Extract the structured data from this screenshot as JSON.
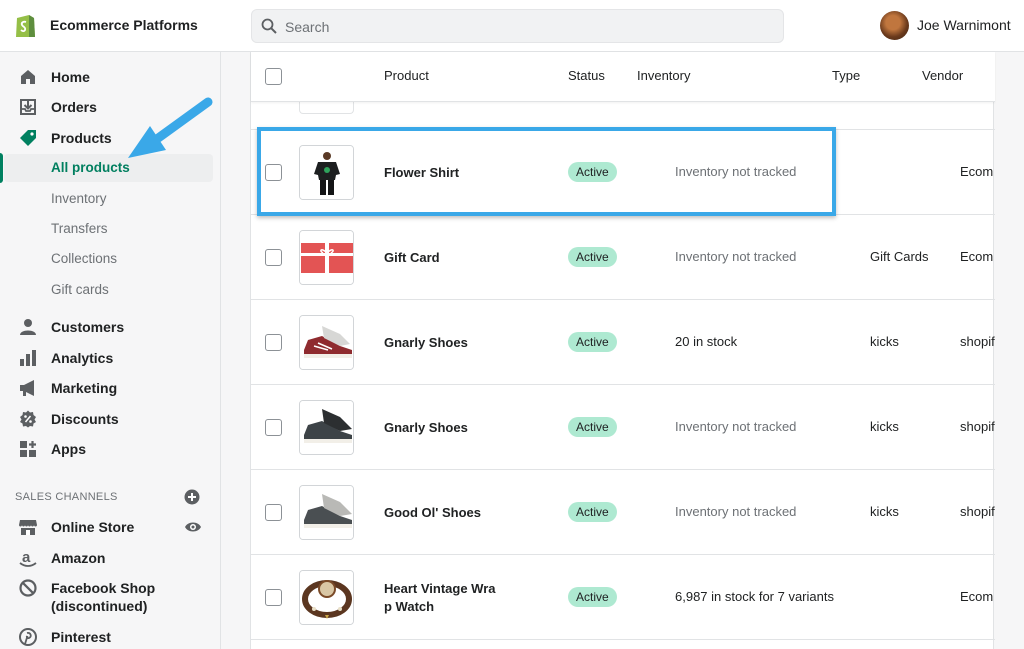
{
  "topbar": {
    "store_name": "Ecommerce Platforms",
    "search_placeholder": "Search",
    "user_name": "Joe Warnimont"
  },
  "sidebar": {
    "items": [
      {
        "label": "Home",
        "icon": "home-icon"
      },
      {
        "label": "Orders",
        "icon": "orders-icon"
      },
      {
        "label": "Products",
        "icon": "tag-icon"
      }
    ],
    "product_sub_items": [
      {
        "label": "All products",
        "active": true
      },
      {
        "label": "Inventory"
      },
      {
        "label": "Transfers"
      },
      {
        "label": "Collections"
      },
      {
        "label": "Gift cards"
      }
    ],
    "more_items": [
      {
        "label": "Customers",
        "icon": "customers-icon"
      },
      {
        "label": "Analytics",
        "icon": "analytics-icon"
      },
      {
        "label": "Marketing",
        "icon": "megaphone-icon"
      },
      {
        "label": "Discounts",
        "icon": "discount-icon"
      },
      {
        "label": "Apps",
        "icon": "apps-icon"
      }
    ],
    "sales_channels_label": "SALES CHANNELS",
    "channels": [
      {
        "label": "Online Store",
        "icon": "store-icon"
      },
      {
        "label": "Amazon",
        "icon": "amazon-icon"
      },
      {
        "label": "Facebook Shop",
        "label2": "(discontinued)",
        "icon": "blocked-icon"
      },
      {
        "label": "Pinterest",
        "icon": "pinterest-icon"
      }
    ]
  },
  "table": {
    "headers": {
      "product": "Product",
      "status": "Status",
      "inventory": "Inventory",
      "type": "Type",
      "vendor": "Vendor"
    },
    "rows": [
      {
        "name": "Flower Shirt",
        "status": "Active",
        "inventory": "Inventory not tracked",
        "type": "",
        "vendor": "Ecom"
      },
      {
        "name": "Gift Card",
        "status": "Active",
        "inventory": "Inventory not tracked",
        "type": "Gift Cards",
        "vendor": "Ecom"
      },
      {
        "name": "Gnarly Shoes",
        "status": "Active",
        "inventory": "20 in stock",
        "type": "kicks",
        "vendor": "shopif"
      },
      {
        "name": "Gnarly Shoes",
        "status": "Active",
        "inventory": "Inventory not tracked",
        "type": "kicks",
        "vendor": "shopif"
      },
      {
        "name": "Good Ol' Shoes",
        "status": "Active",
        "inventory": "Inventory not tracked",
        "type": "kicks",
        "vendor": "shopif"
      },
      {
        "name": "Heart Vintage Wra",
        "name2": "p Watch",
        "status": "Active",
        "inventory": "6,987 in stock for 7 variants",
        "type": "",
        "vendor": "Ecom"
      }
    ]
  },
  "colors": {
    "accent_green": "#008060",
    "badge_green": "#aee9d1",
    "highlight_blue": "#3aa8e8"
  }
}
